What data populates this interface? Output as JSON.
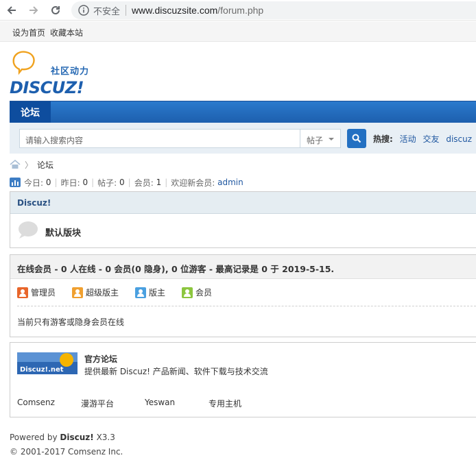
{
  "browser": {
    "security_label": "不安全",
    "url_host": "www.discuzsite.com",
    "url_path": "/forum.php"
  },
  "toplinks": {
    "set_homepage": "设为首页",
    "bookmark": "收藏本站"
  },
  "logo": {
    "tagline": "社区动力",
    "wordmark": "DISCUZ!"
  },
  "nav": {
    "active_tab": "论坛"
  },
  "search": {
    "placeholder": "请输入搜索内容",
    "scope": "帖子",
    "hot_label": "热搜:",
    "hot_items": [
      "活动",
      "交友",
      "discuz"
    ]
  },
  "breadcrumb": {
    "current": "论坛"
  },
  "stats": {
    "today_label": "今日:",
    "today_value": "0",
    "yesterday_label": "昨日:",
    "yesterday_value": "0",
    "posts_label": "帖子:",
    "posts_value": "0",
    "members_label": "会员:",
    "members_value": "1",
    "newest_label": "欢迎新会员:",
    "newest_member": "admin"
  },
  "forum_group": {
    "title": "Discuz!",
    "forum_name": "默认版块"
  },
  "online": {
    "header": "在线会员 - 0 人在线 - 0 会员(0 隐身), 0 位游客 - 最高记录是 0 于 2019-5-15.",
    "legend": [
      "管理员",
      "超级版主",
      "版主",
      "会员"
    ],
    "message": "当前只有游客或隐身会员在线"
  },
  "partners": {
    "logo_text": "Discuz!.net",
    "title": "官方论坛",
    "description": "提供最新 Discuz! 产品新闻、软件下载与技术交流",
    "links": [
      "Comsenz",
      "漫游平台",
      "Yeswan",
      "专用主机"
    ]
  },
  "footer": {
    "powered_prefix": "Powered by",
    "product": "Discuz!",
    "version": "X3.3",
    "copyright": "© 2001-2017 Comsenz Inc."
  },
  "colors": {
    "nav_blue": "#2370c2",
    "link_blue": "#1f57a0",
    "legend_admin": "#e8662b",
    "legend_supermod": "#f0a030",
    "legend_mod": "#4aa0e0",
    "legend_member": "#8cc63f"
  }
}
